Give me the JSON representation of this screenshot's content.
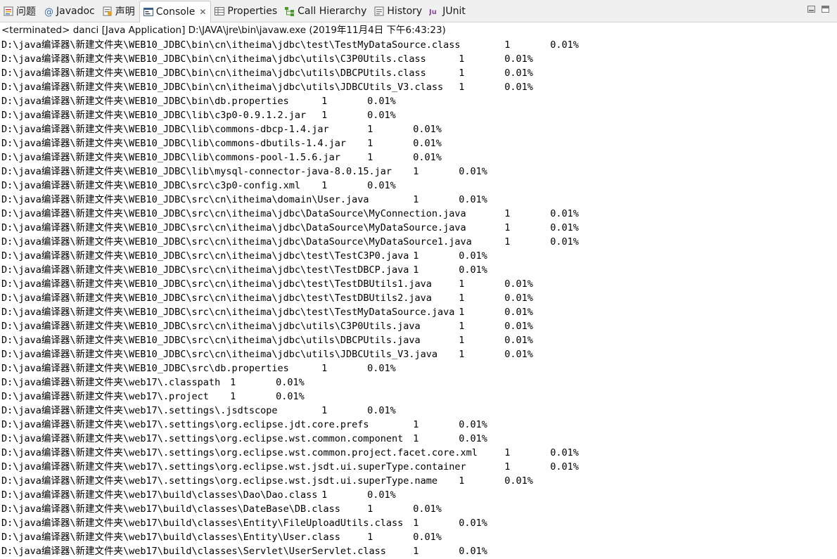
{
  "tabs": [
    {
      "label": "问题",
      "icon": "problems-icon",
      "active": false
    },
    {
      "label": "Javadoc",
      "icon": "javadoc-icon",
      "active": false
    },
    {
      "label": "声明",
      "icon": "declaration-icon",
      "active": false
    },
    {
      "label": "Console",
      "icon": "console-icon",
      "active": true,
      "close": "✕"
    },
    {
      "label": "Properties",
      "icon": "properties-icon",
      "active": false
    },
    {
      "label": "Call Hierarchy",
      "icon": "call-hierarchy-icon",
      "active": false
    },
    {
      "label": "History",
      "icon": "history-icon",
      "active": false
    },
    {
      "label": "JUnit",
      "icon": "junit-icon",
      "active": false
    }
  ],
  "console": {
    "status": "<terminated> danci [Java Application] D:\\JAVA\\jre\\bin\\javaw.exe (2019年11月4日 下午6:43:23)",
    "lines": [
      "D:\\java编译器\\新建文件夹\\WEB10_JDBC\\bin\\cn\\itheima\\jdbc\\test\\TestMyDataSource.class\t1\t0.01%",
      "D:\\java编译器\\新建文件夹\\WEB10_JDBC\\bin\\cn\\itheima\\jdbc\\utils\\C3P0Utils.class\t1\t0.01%",
      "D:\\java编译器\\新建文件夹\\WEB10_JDBC\\bin\\cn\\itheima\\jdbc\\utils\\DBCPUtils.class\t1\t0.01%",
      "D:\\java编译器\\新建文件夹\\WEB10_JDBC\\bin\\cn\\itheima\\jdbc\\utils\\JDBCUtils_V3.class\t1\t0.01%",
      "D:\\java编译器\\新建文件夹\\WEB10_JDBC\\bin\\db.properties\t1\t0.01%",
      "D:\\java编译器\\新建文件夹\\WEB10_JDBC\\lib\\c3p0-0.9.1.2.jar\t1\t0.01%",
      "D:\\java编译器\\新建文件夹\\WEB10_JDBC\\lib\\commons-dbcp-1.4.jar\t1\t0.01%",
      "D:\\java编译器\\新建文件夹\\WEB10_JDBC\\lib\\commons-dbutils-1.4.jar\t1\t0.01%",
      "D:\\java编译器\\新建文件夹\\WEB10_JDBC\\lib\\commons-pool-1.5.6.jar\t1\t0.01%",
      "D:\\java编译器\\新建文件夹\\WEB10_JDBC\\lib\\mysql-connector-java-8.0.15.jar\t1\t0.01%",
      "D:\\java编译器\\新建文件夹\\WEB10_JDBC\\src\\c3p0-config.xml\t1\t0.01%",
      "D:\\java编译器\\新建文件夹\\WEB10_JDBC\\src\\cn\\itheima\\domain\\User.java\t1\t0.01%",
      "D:\\java编译器\\新建文件夹\\WEB10_JDBC\\src\\cn\\itheima\\jdbc\\DataSource\\MyConnection.java\t1\t0.01%",
      "D:\\java编译器\\新建文件夹\\WEB10_JDBC\\src\\cn\\itheima\\jdbc\\DataSource\\MyDataSource.java\t1\t0.01%",
      "D:\\java编译器\\新建文件夹\\WEB10_JDBC\\src\\cn\\itheima\\jdbc\\DataSource\\MyDataSource1.java\t1\t0.01%",
      "D:\\java编译器\\新建文件夹\\WEB10_JDBC\\src\\cn\\itheima\\jdbc\\test\\TestC3P0.java\t1\t0.01%",
      "D:\\java编译器\\新建文件夹\\WEB10_JDBC\\src\\cn\\itheima\\jdbc\\test\\TestDBCP.java\t1\t0.01%",
      "D:\\java编译器\\新建文件夹\\WEB10_JDBC\\src\\cn\\itheima\\jdbc\\test\\TestDBUtils1.java\t1\t0.01%",
      "D:\\java编译器\\新建文件夹\\WEB10_JDBC\\src\\cn\\itheima\\jdbc\\test\\TestDBUtils2.java\t1\t0.01%",
      "D:\\java编译器\\新建文件夹\\WEB10_JDBC\\src\\cn\\itheima\\jdbc\\test\\TestMyDataSource.java\t1\t0.01%",
      "D:\\java编译器\\新建文件夹\\WEB10_JDBC\\src\\cn\\itheima\\jdbc\\utils\\C3P0Utils.java\t1\t0.01%",
      "D:\\java编译器\\新建文件夹\\WEB10_JDBC\\src\\cn\\itheima\\jdbc\\utils\\DBCPUtils.java\t1\t0.01%",
      "D:\\java编译器\\新建文件夹\\WEB10_JDBC\\src\\cn\\itheima\\jdbc\\utils\\JDBCUtils_V3.java\t1\t0.01%",
      "D:\\java编译器\\新建文件夹\\WEB10_JDBC\\src\\db.properties\t1\t0.01%",
      "D:\\java编译器\\新建文件夹\\web17\\.classpath\t1\t0.01%",
      "D:\\java编译器\\新建文件夹\\web17\\.project\t1\t0.01%",
      "D:\\java编译器\\新建文件夹\\web17\\.settings\\.jsdtscope\t1\t0.01%",
      "D:\\java编译器\\新建文件夹\\web17\\.settings\\org.eclipse.jdt.core.prefs\t1\t0.01%",
      "D:\\java编译器\\新建文件夹\\web17\\.settings\\org.eclipse.wst.common.component\t1\t0.01%",
      "D:\\java编译器\\新建文件夹\\web17\\.settings\\org.eclipse.wst.common.project.facet.core.xml\t1\t0.01%",
      "D:\\java编译器\\新建文件夹\\web17\\.settings\\org.eclipse.wst.jsdt.ui.superType.container\t1\t0.01%",
      "D:\\java编译器\\新建文件夹\\web17\\.settings\\org.eclipse.wst.jsdt.ui.superType.name\t1\t0.01%",
      "D:\\java编译器\\新建文件夹\\web17\\build\\classes\\Dao\\Dao.class\t1\t0.01%",
      "D:\\java编译器\\新建文件夹\\web17\\build\\classes\\DateBase\\DB.class\t1\t0.01%",
      "D:\\java编译器\\新建文件夹\\web17\\build\\classes\\Entity\\FileUploadUtils.class\t1\t0.01%",
      "D:\\java编译器\\新建文件夹\\web17\\build\\classes\\Entity\\User.class\t1\t0.01%",
      "D:\\java编译器\\新建文件夹\\web17\\build\\classes\\Servlet\\UserServlet.class\t1\t0.01%"
    ]
  }
}
